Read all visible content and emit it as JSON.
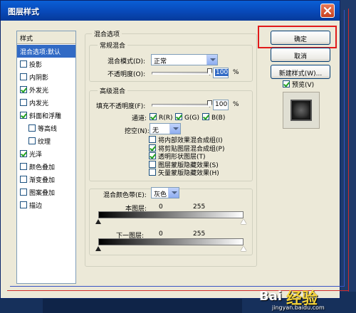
{
  "window": {
    "title": "图层样式"
  },
  "styles_list": {
    "header": "样式",
    "items": [
      {
        "label": "混合选项:默认",
        "checkbox": false,
        "checked": false,
        "selected": true
      },
      {
        "label": "投影",
        "checkbox": true,
        "checked": false,
        "selected": false
      },
      {
        "label": "内阴影",
        "checkbox": true,
        "checked": false,
        "selected": false
      },
      {
        "label": "外发光",
        "checkbox": true,
        "checked": true,
        "selected": false
      },
      {
        "label": "内发光",
        "checkbox": true,
        "checked": false,
        "selected": false
      },
      {
        "label": "斜面和浮雕",
        "checkbox": true,
        "checked": true,
        "selected": false
      },
      {
        "label": "等高线",
        "checkbox": true,
        "checked": false,
        "selected": false,
        "indent": true
      },
      {
        "label": "纹理",
        "checkbox": true,
        "checked": false,
        "selected": false,
        "indent": true
      },
      {
        "label": "光泽",
        "checkbox": true,
        "checked": true,
        "selected": false
      },
      {
        "label": "颜色叠加",
        "checkbox": true,
        "checked": false,
        "selected": false
      },
      {
        "label": "渐变叠加",
        "checkbox": true,
        "checked": false,
        "selected": false
      },
      {
        "label": "图案叠加",
        "checkbox": true,
        "checked": false,
        "selected": false
      },
      {
        "label": "描边",
        "checkbox": true,
        "checked": false,
        "selected": false
      }
    ]
  },
  "blending_options": {
    "title": "混合选项",
    "general": {
      "title": "常规混合",
      "blend_mode_label": "混合模式(D):",
      "blend_mode_value": "正常",
      "opacity_label": "不透明度(O):",
      "opacity_value": "100",
      "opacity_unit": "%",
      "opacity_level": 1.0
    },
    "advanced": {
      "title": "高级混合",
      "fill_opacity_label": "填充不透明度(F):",
      "fill_opacity_value": "100",
      "fill_opacity_unit": "%",
      "fill_opacity_level": 1.0,
      "channels_label": "通道:",
      "channels": [
        {
          "label": "R(R)",
          "checked": true
        },
        {
          "label": "G(G)",
          "checked": true
        },
        {
          "label": "B(B)",
          "checked": true
        }
      ],
      "knockout_label": "挖空(N):",
      "knockout_value": "无",
      "options": [
        {
          "label": "将内部效果混合成组(I)",
          "checked": false
        },
        {
          "label": "将剪贴图层混合成组(P)",
          "checked": true
        },
        {
          "label": "透明形状图层(T)",
          "checked": true
        },
        {
          "label": "图层蒙版隐藏效果(S)",
          "checked": false
        },
        {
          "label": "矢量蒙版隐藏效果(H)",
          "checked": false
        }
      ]
    },
    "blend_if": {
      "label": "混合颜色带(E):",
      "value": "灰色",
      "this_layer_label": "本图层:",
      "this_layer_min": "0",
      "this_layer_max": "255",
      "underlying_label": "下一图层:",
      "underlying_min": "0",
      "underlying_max": "255"
    }
  },
  "buttons": {
    "ok": "确定",
    "cancel": "取消",
    "new_style": "新建样式(W)...",
    "preview_label": "预览(V)",
    "preview_checked": true
  },
  "watermark": {
    "text": "Bai",
    "text2": "经验",
    "url": "jingyan.baidu.com"
  },
  "colors": {
    "accent": "#316ac5",
    "titlebar": "#0849b8",
    "highlight_frame": "#e11a1a"
  }
}
